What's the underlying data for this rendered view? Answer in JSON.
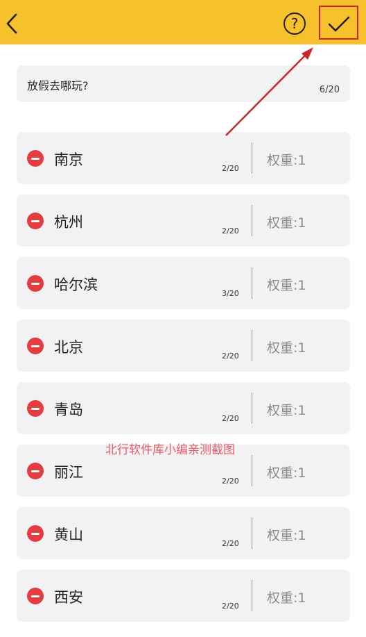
{
  "header": {
    "back_icon": "chevron-left-icon",
    "help_icon": "question-circle-icon",
    "help_glyph": "?",
    "confirm_icon": "checkmark-icon"
  },
  "question": {
    "text": "放假去哪玩?",
    "count": "6/20"
  },
  "options": [
    {
      "name": "南京",
      "count": "2/20",
      "weight": "权重:1"
    },
    {
      "name": "杭州",
      "count": "2/20",
      "weight": "权重:1"
    },
    {
      "name": "哈尔滨",
      "count": "3/20",
      "weight": "权重:1"
    },
    {
      "name": "北京",
      "count": "2/20",
      "weight": "权重:1"
    },
    {
      "name": "青岛",
      "count": "2/20",
      "weight": "权重:1"
    },
    {
      "name": "丽江",
      "count": "2/20",
      "weight": "权重:1"
    },
    {
      "name": "黄山",
      "count": "2/20",
      "weight": "权重:1"
    },
    {
      "name": "西安",
      "count": "2/20",
      "weight": "权重:1"
    }
  ],
  "watermark": "北行软件库小编亲测截图",
  "colors": {
    "header_bg": "#f7c12c",
    "card_bg": "#f2f2f4",
    "remove_red": "#e63b3f",
    "annotation_red": "#d0242b"
  }
}
